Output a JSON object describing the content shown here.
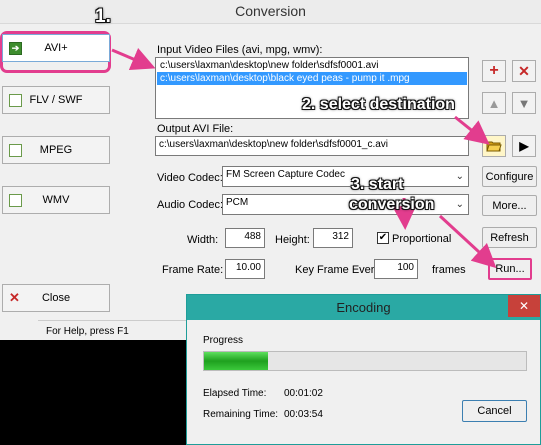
{
  "window": {
    "title": "Conversion"
  },
  "sidebar": {
    "items": [
      {
        "label": "AVI+",
        "active": true
      },
      {
        "label": "FLV / SWF"
      },
      {
        "label": "MPEG"
      },
      {
        "label": "WMV"
      }
    ],
    "close_label": "Close"
  },
  "input": {
    "label": "Input Video Files (avi, mpg, wmv):",
    "files": [
      "c:\\users\\laxman\\desktop\\new folder\\sdfsf0001.avi",
      "c:\\users\\laxman\\desktop\\black eyed peas - pump it .mpg"
    ],
    "selected_index": 1
  },
  "output": {
    "label": "Output AVI File:",
    "value": "c:\\users\\laxman\\desktop\\new folder\\sdfsf0001_c.avi"
  },
  "video_codec": {
    "label": "Video Codec:",
    "value": "FM Screen Capture Codec",
    "button": "Configure"
  },
  "audio_codec": {
    "label": "Audio Codec:",
    "value": "PCM",
    "button": "More..."
  },
  "dimensions": {
    "width_label": "Width:",
    "width": "488",
    "height_label": "Height:",
    "height": "312",
    "proportional_label": "Proportional",
    "proportional_checked": true,
    "refresh": "Refresh"
  },
  "frame": {
    "rate_label": "Frame Rate:",
    "rate": "10.00",
    "key_label": "Key Frame Every:",
    "key": "100",
    "key_unit": "frames",
    "run": "Run..."
  },
  "status_bar": "For Help, press F1",
  "annotations": {
    "step1": "1.",
    "step2": "2. select destination",
    "step3a": "3. start",
    "step3b": "conversion",
    "color": "#e23d8e"
  },
  "encoding": {
    "title": "Encoding",
    "progress_label": "Progress",
    "progress": 0.2,
    "elapsed_label": "Elapsed Time:",
    "elapsed": "00:01:02",
    "remaining_label": "Remaining Time:",
    "remaining": "00:03:54",
    "cancel": "Cancel",
    "close_glyph": "✕"
  },
  "icons": {
    "add": "+",
    "remove": "✕",
    "up": "up-arrow-icon",
    "down": "down-arrow-icon",
    "folder": "folder-open-icon",
    "play": "play-icon"
  }
}
